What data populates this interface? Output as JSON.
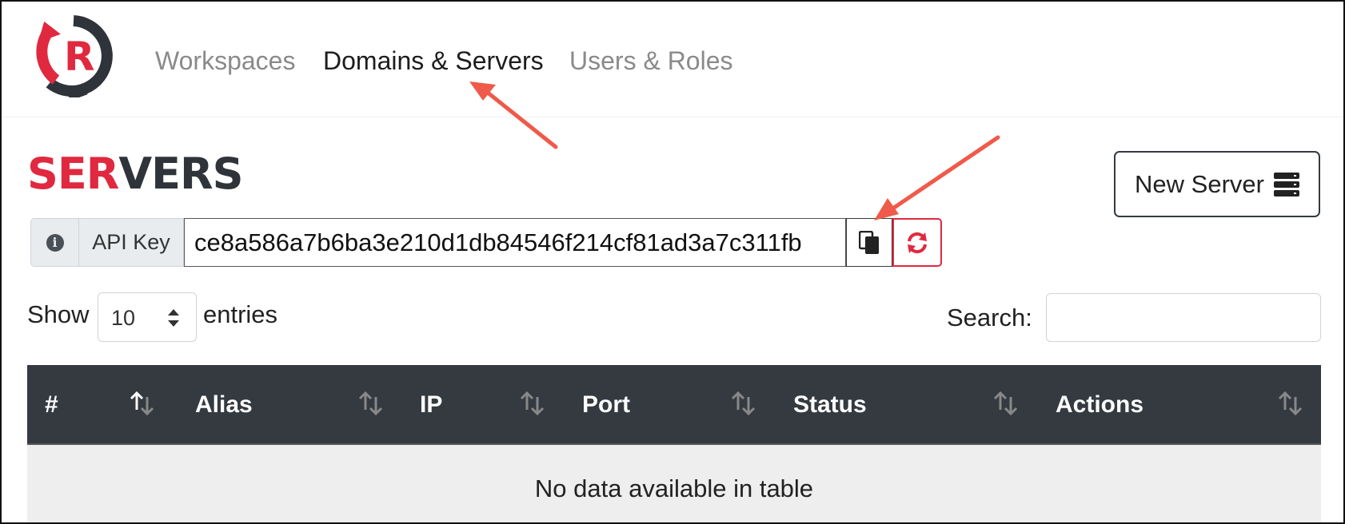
{
  "nav": {
    "items": [
      {
        "label": "Workspaces",
        "active": false
      },
      {
        "label": "Domains & Servers",
        "active": true
      },
      {
        "label": "Users & Roles",
        "active": false
      }
    ]
  },
  "page": {
    "title_accent": "SER",
    "title_rest": "VERS",
    "new_server_label": "New Server"
  },
  "api_key": {
    "label": "API Key",
    "value": "ce8a586a7b6ba3e210d1db84546f214cf81ad3a7c311fb"
  },
  "table_controls": {
    "show_label": "Show",
    "entries_value": "10",
    "entries_label": "entries",
    "search_label": "Search:"
  },
  "table": {
    "columns": [
      "#",
      "Alias",
      "IP",
      "Port",
      "Status",
      "Actions"
    ],
    "empty_message": "No data available in table"
  },
  "colors": {
    "accent": "#e0293f",
    "dark": "#343a40",
    "annotation_arrow": "#ef5a4a"
  },
  "icons": {
    "logo": "r-logo-icon",
    "server": "server-icon",
    "info": "info-icon",
    "copy": "copy-icon",
    "refresh": "refresh-icon",
    "sort": "sort-icon",
    "select_arrows": "select-arrows-icon"
  }
}
